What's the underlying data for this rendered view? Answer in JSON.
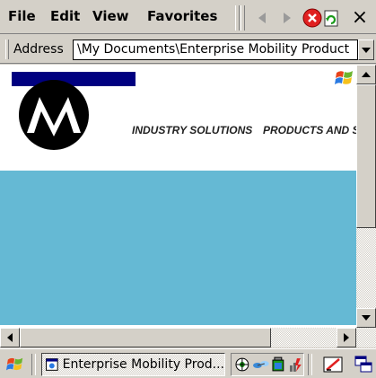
{
  "menubar": {
    "items": [
      "File",
      "Edit",
      "View",
      "Favorites"
    ],
    "toolbar_icons": [
      "back-icon",
      "forward-icon",
      "stop-icon",
      "refresh-icon",
      "close-icon"
    ],
    "close_label": "×"
  },
  "address": {
    "label": "Address",
    "value": "\\My Documents\\Enterprise Mobility Product"
  },
  "content": {
    "nav_links": [
      "INDUSTRY SOLUTIONS",
      "PRODUCTS AND SER"
    ],
    "banner_color": "#65b9d4",
    "header_block_color": "#000080"
  },
  "taskbar": {
    "task_label": "Enterprise Mobility Prod...",
    "tray_icons": [
      "network-icon",
      "connection-icon",
      "battery-icon",
      "wireless-icon"
    ]
  }
}
